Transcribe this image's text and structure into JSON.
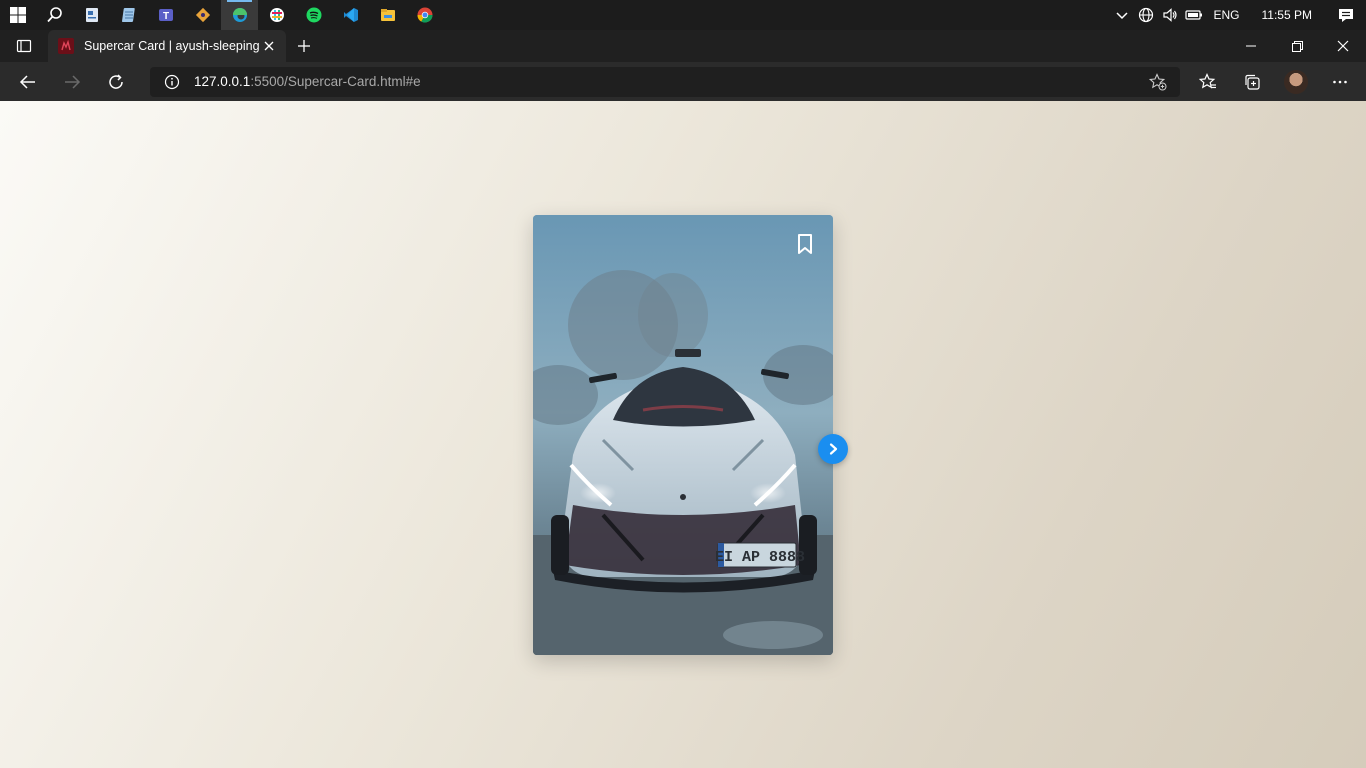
{
  "taskbar": {
    "apps": [
      {
        "name": "search-icon",
        "active": false
      },
      {
        "name": "notes-app-icon",
        "active": false
      },
      {
        "name": "notepad-icon",
        "active": false
      },
      {
        "name": "teams-icon",
        "active": false
      },
      {
        "name": "git-icon",
        "active": false
      },
      {
        "name": "edge-icon",
        "active": true
      },
      {
        "name": "slack-icon",
        "active": false
      },
      {
        "name": "spotify-icon",
        "active": false
      },
      {
        "name": "vscode-icon",
        "active": false
      },
      {
        "name": "file-explorer-icon",
        "active": false
      },
      {
        "name": "chrome-icon",
        "active": false
      }
    ],
    "tray": {
      "language": "ENG",
      "time": "11:55 PM"
    }
  },
  "browser": {
    "tab": {
      "title": "Supercar Card | ayush-sleeping"
    },
    "address": {
      "host": "127.0.0.1",
      "path": ":5500/Supercar-Card.html#e"
    }
  },
  "page": {
    "card": {
      "plate": "EI AP 8888"
    }
  },
  "colors": {
    "accent": "#1a8ef0",
    "page_bg_start": "#fbfaf6",
    "page_bg_end": "#d5ccbb"
  }
}
